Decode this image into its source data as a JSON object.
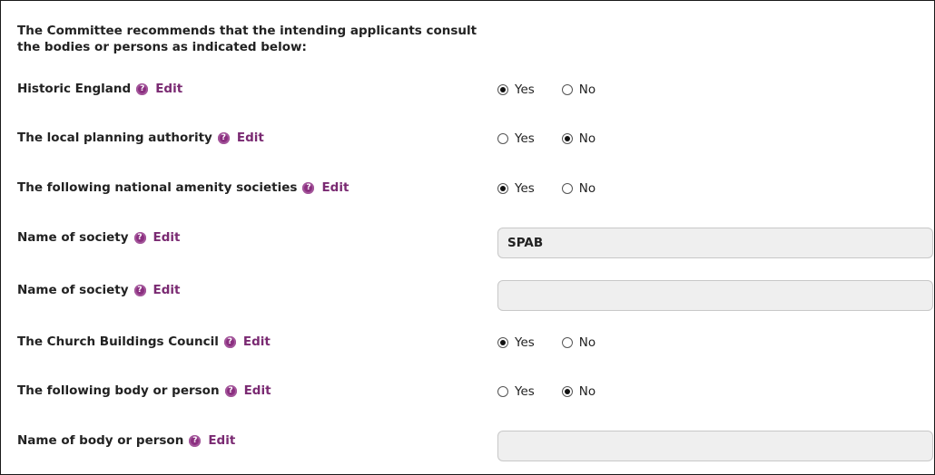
{
  "intro": {
    "line1": "The Committee recommends that the intending applicants consult",
    "line2": "the bodies or persons as indicated below:"
  },
  "help_glyph": "?",
  "edit_label": "Edit",
  "yes_label": "Yes",
  "no_label": "No",
  "rows": [
    {
      "label": "Historic England",
      "type": "radio",
      "selected": "Yes"
    },
    {
      "label": "The local planning authority",
      "type": "radio",
      "selected": "No"
    },
    {
      "label": "The following national amenity societies",
      "type": "radio",
      "selected": "Yes"
    },
    {
      "label": "Name of society",
      "type": "text",
      "value": "SPAB"
    },
    {
      "label": "Name of society",
      "type": "text",
      "value": ""
    },
    {
      "label": "The Church Buildings Council",
      "type": "radio",
      "selected": "Yes"
    },
    {
      "label": "The following body or person",
      "type": "radio",
      "selected": "No"
    },
    {
      "label": "Name of body or person",
      "type": "text",
      "value": ""
    }
  ],
  "colors": {
    "link": "#7a2a72",
    "help_icon": "#8b2f80",
    "field_bg": "#efefef"
  }
}
